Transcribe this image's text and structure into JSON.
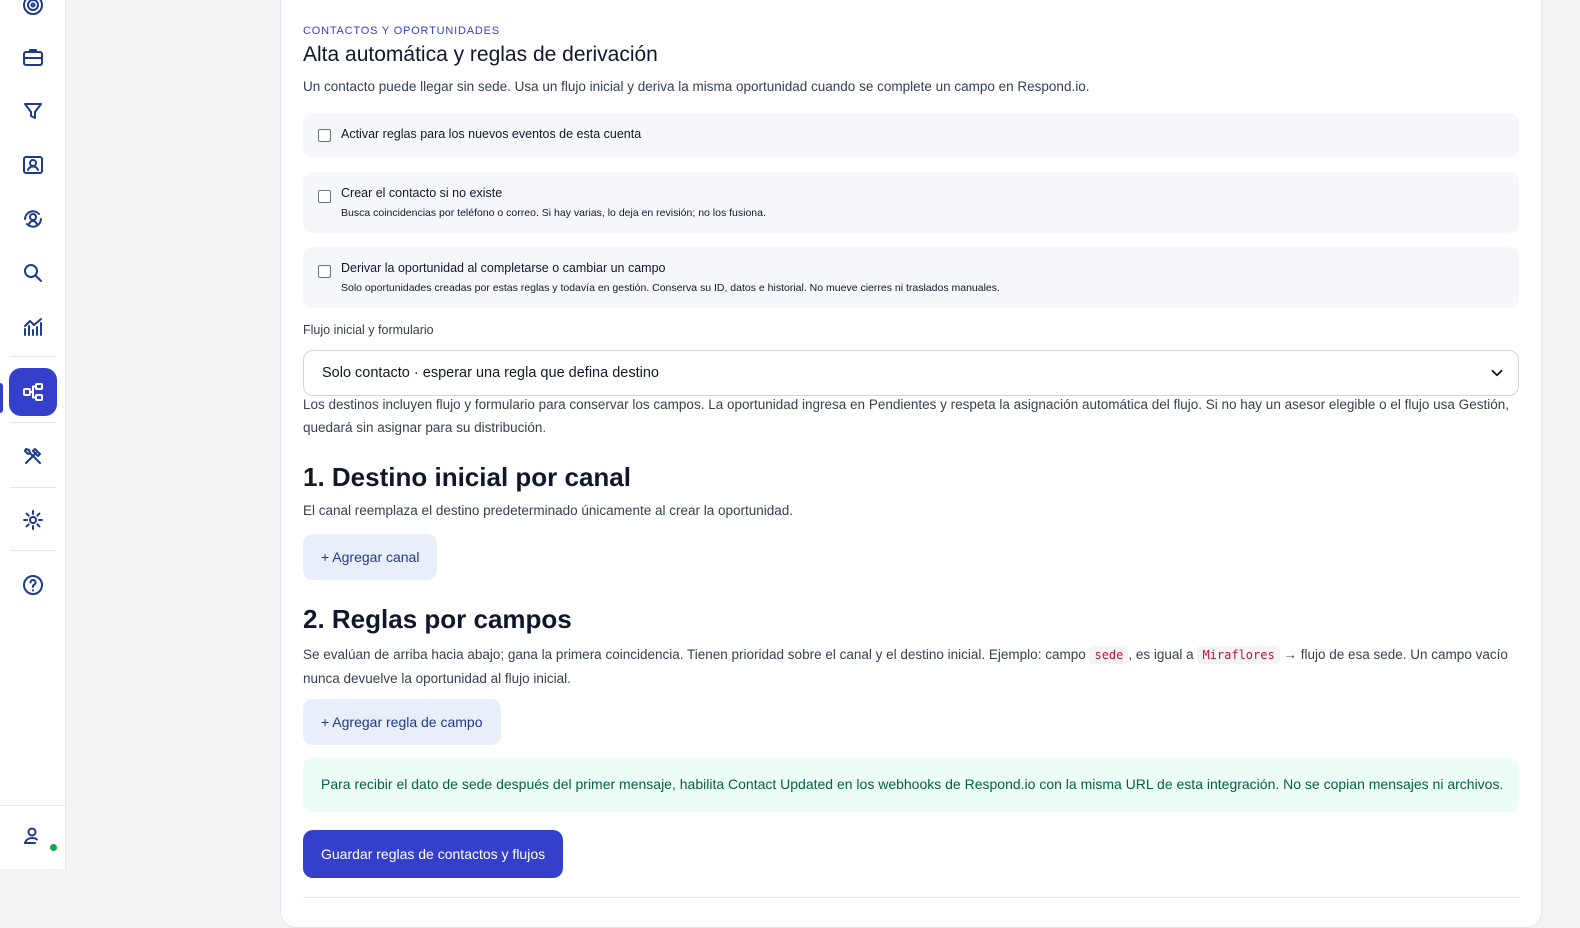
{
  "sidebar": {
    "items": [
      {
        "icon": "target-icon"
      },
      {
        "icon": "briefcase-icon"
      },
      {
        "icon": "filter-icon"
      },
      {
        "icon": "contact-card-icon"
      },
      {
        "icon": "user-sync-icon"
      },
      {
        "icon": "search-icon"
      },
      {
        "icon": "chart-icon"
      },
      {
        "icon": "flow-icon",
        "active": true
      },
      {
        "icon": "tools-icon"
      },
      {
        "icon": "gear-icon"
      },
      {
        "icon": "help-icon"
      }
    ],
    "user_status_color": "#16a34a"
  },
  "section": {
    "eyebrow": "CONTACTOS Y OPORTUNIDADES",
    "title": "Alta automática y reglas de derivación",
    "description": "Un contacto puede llegar sin sede. Usa un flujo inicial y deriva la misma oportunidad cuando se complete un campo en Respond.io."
  },
  "options": [
    {
      "label": "Activar reglas para los nuevos eventos de esta cuenta",
      "hint": "",
      "checked": false
    },
    {
      "label": "Crear el contacto si no existe",
      "hint": "Busca coincidencias por teléfono o correo. Si hay varias, lo deja en revisión; no los fusiona.",
      "checked": false
    },
    {
      "label": "Derivar la oportunidad al completarse o cambiar un campo",
      "hint": "Solo oportunidades creadas por estas reglas y todavía en gestión. Conserva su ID, datos e historial. No mueve cierres ni traslados manuales.",
      "checked": false
    }
  ],
  "flow": {
    "label": "Flujo inicial y formulario",
    "selected": "Solo contacto · esperar una regla que defina destino",
    "note": "Los destinos incluyen flujo y formulario para conservar los campos. La oportunidad ingresa en Pendientes y respeta la asignación automática del flujo. Si no hay un asesor elegible o el flujo usa Gestión, quedará sin asignar para su distribución."
  },
  "channel": {
    "heading": "1. Destino inicial por canal",
    "description": "El canal reemplaza el destino predeterminado únicamente al crear la oportunidad.",
    "add_label": "+ Agregar canal"
  },
  "fields": {
    "heading": "2. Reglas por campos",
    "desc_part1": "Se evalúan de arriba hacia abajo; gana la primera coincidencia. Tienen prioridad sobre el canal y el destino inicial. Ejemplo: campo",
    "code1": "sede",
    "desc_part2": ", es igual a",
    "code2": "Miraflores",
    "desc_part3": "→ flujo de esa sede. Un campo vacío nunca devuelve la oportunidad al flujo inicial.",
    "add_label": "+ Agregar regla de campo"
  },
  "notice": {
    "text": "Para recibir el dato de sede después del primer mensaje, habilita Contact Updated en los webhooks de Respond.io con la misma URL de esta integración. No se copian mensajes ni archivos."
  },
  "save_label": "Guardar reglas de contactos y flujos"
}
